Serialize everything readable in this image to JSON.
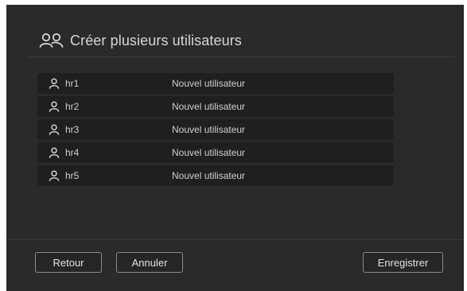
{
  "dialog": {
    "title": "Créer plusieurs utilisateurs",
    "title_icon": "users-icon"
  },
  "users": [
    {
      "name": "hr1",
      "status": "Nouvel utilisateur",
      "icon": "user-icon"
    },
    {
      "name": "hr2",
      "status": "Nouvel utilisateur",
      "icon": "user-icon"
    },
    {
      "name": "hr3",
      "status": "Nouvel utilisateur",
      "icon": "user-icon"
    },
    {
      "name": "hr4",
      "status": "Nouvel utilisateur",
      "icon": "user-icon"
    },
    {
      "name": "hr5",
      "status": "Nouvel utilisateur",
      "icon": "user-icon"
    }
  ],
  "footer": {
    "back_label": "Retour",
    "cancel_label": "Annuler",
    "save_label": "Enregistrer"
  },
  "colors": {
    "background": "#2a2a2a",
    "row_background": "#1f1f1f",
    "text": "#cfcfcf",
    "button_border": "#8a8a8a"
  }
}
